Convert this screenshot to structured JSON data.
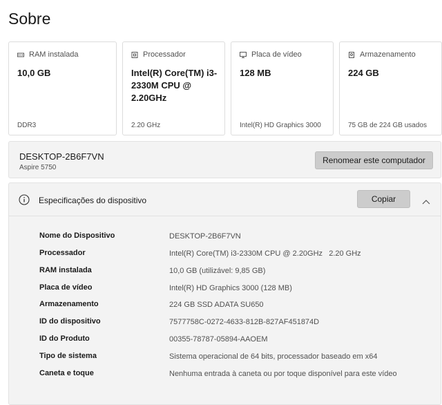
{
  "page": {
    "title": "Sobre"
  },
  "cards": [
    {
      "icon": "ram-icon",
      "label": "RAM instalada",
      "value": "10,0 GB",
      "sub": "DDR3"
    },
    {
      "icon": "processor-icon",
      "label": "Processador",
      "value": "Intel(R) Core(TM) i3-2330M CPU @ 2.20GHz",
      "sub": "2.20 GHz"
    },
    {
      "icon": "display-icon",
      "label": "Placa de vídeo",
      "value": "128 MB",
      "sub": "Intel(R) HD Graphics 3000"
    },
    {
      "icon": "storage-icon",
      "label": "Armazenamento",
      "value": "224 GB",
      "sub": "75 GB de 224 GB usados"
    }
  ],
  "device": {
    "name": "DESKTOP-2B6F7VN",
    "model": "Aspire 5750",
    "rename_label": "Renomear este computador"
  },
  "specs": {
    "title": "Especificações do dispositivo",
    "copy_label": "Copiar",
    "rows": [
      {
        "key": "Nome do Dispositivo",
        "value": "DESKTOP-2B6F7VN"
      },
      {
        "key": "Processador",
        "value": "Intel(R) Core(TM) i3-2330M CPU @ 2.20GHz   2.20 GHz"
      },
      {
        "key": "RAM instalada",
        "value": "10,0 GB (utilizável: 9,85 GB)"
      },
      {
        "key": "Placa de vídeo",
        "value": "Intel(R) HD Graphics 3000 (128 MB)"
      },
      {
        "key": "Armazenamento",
        "value": "224 GB SSD ADATA SU650"
      },
      {
        "key": "ID do dispositivo",
        "value": "7577758C-0272-4633-812B-827AF451874D"
      },
      {
        "key": "ID do Produto",
        "value": "00355-78787-05894-AAOEM"
      },
      {
        "key": "Tipo de sistema",
        "value": "Sistema operacional de 64 bits, processador baseado em x64"
      },
      {
        "key": "Caneta e toque",
        "value": "Nenhuma entrada à caneta ou por toque disponível para este vídeo"
      }
    ]
  }
}
